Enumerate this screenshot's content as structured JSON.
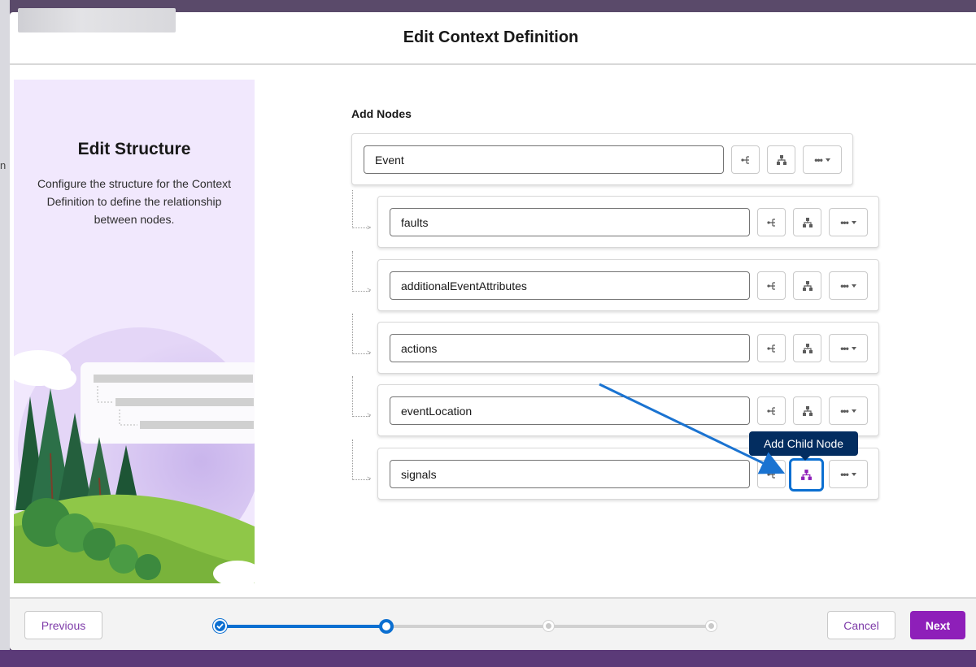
{
  "modal": {
    "title": "Edit Context Definition"
  },
  "left_panel": {
    "title": "Edit Structure",
    "description": "Configure the structure for the Context Definition to define the relationship between nodes."
  },
  "main": {
    "section_label": "Add Nodes",
    "root_node": {
      "value": "Event"
    },
    "child_nodes": [
      {
        "value": "faults"
      },
      {
        "value": "additionalEventAttributes"
      },
      {
        "value": "actions"
      },
      {
        "value": "eventLocation"
      },
      {
        "value": "signals"
      }
    ],
    "tooltip": "Add Child Node",
    "more_dots": "•••"
  },
  "footer": {
    "previous_label": "Previous",
    "cancel_label": "Cancel",
    "next_label": "Next",
    "progress": {
      "total_steps": 4,
      "current_step": 2,
      "completed_steps": 1
    }
  },
  "colors": {
    "brand": "#8e1fb9",
    "progress_active": "#0b6fd1",
    "tooltip_bg": "#032d60",
    "panel_bg": "#f1e8fd"
  },
  "icons": {
    "sibling": "add-sibling-icon",
    "child": "add-child-node-icon",
    "more": "more-actions-icon",
    "check": "check-icon"
  }
}
